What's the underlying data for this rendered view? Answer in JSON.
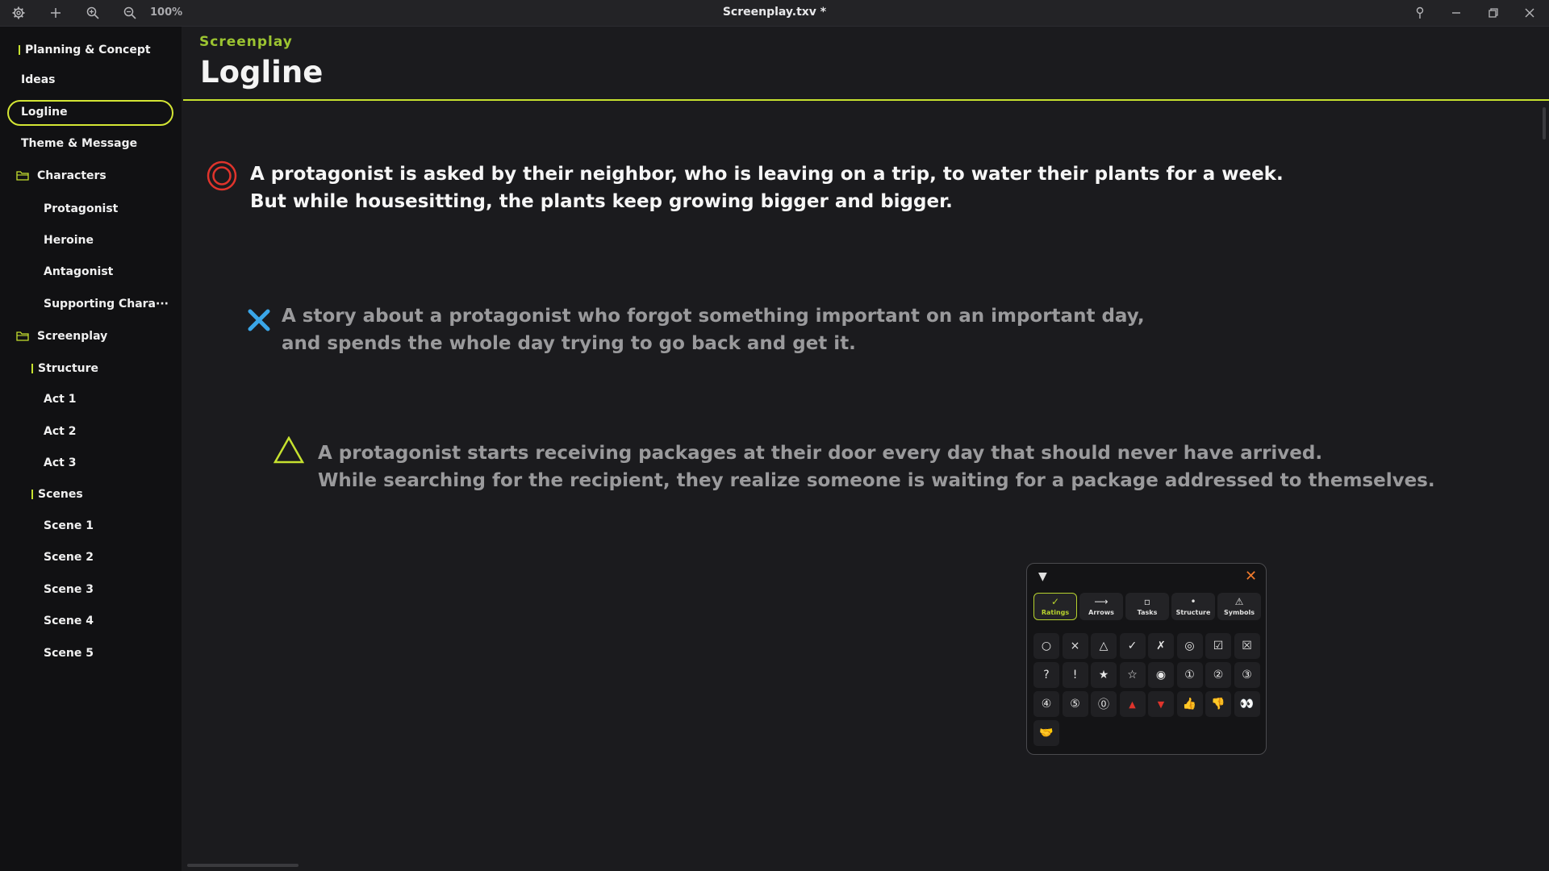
{
  "titlebar": {
    "zoom": "100%",
    "title": "Screenplay.txv *"
  },
  "sidebar": {
    "items": [
      {
        "label": "Planning & Concept",
        "kind": "section"
      },
      {
        "label": "Ideas",
        "kind": "item"
      },
      {
        "label": "Logline",
        "kind": "item",
        "active": true
      },
      {
        "label": "Theme & Message",
        "kind": "item"
      },
      {
        "label": "Characters",
        "kind": "folder"
      },
      {
        "label": "Protagonist",
        "kind": "sub"
      },
      {
        "label": "Heroine",
        "kind": "sub"
      },
      {
        "label": "Antagonist",
        "kind": "sub"
      },
      {
        "label": "Supporting Chara···",
        "kind": "sub"
      },
      {
        "label": "Screenplay",
        "kind": "folder"
      },
      {
        "label": "Structure",
        "kind": "subsection"
      },
      {
        "label": "Act 1",
        "kind": "sub"
      },
      {
        "label": "Act 2",
        "kind": "sub"
      },
      {
        "label": "Act 3",
        "kind": "sub"
      },
      {
        "label": "Scenes",
        "kind": "subsection"
      },
      {
        "label": "Scene 1",
        "kind": "sub"
      },
      {
        "label": "Scene 2",
        "kind": "sub"
      },
      {
        "label": "Scene 3",
        "kind": "sub"
      },
      {
        "label": "Scene 4",
        "kind": "sub"
      },
      {
        "label": "Scene 5",
        "kind": "sub"
      }
    ]
  },
  "main": {
    "subtitle": "Screenplay",
    "title": "Logline",
    "loglines": [
      {
        "mark": "double-circle",
        "lines": [
          "A protagonist is asked by their neighbor, who is leaving on a trip, to water their plants for a week.",
          "But while housesitting, the plants keep growing bigger and bigger."
        ]
      },
      {
        "mark": "cross",
        "lines": [
          "A story about a protagonist who forgot something important on an important day,",
          "and spends the whole day trying to go back and get it."
        ]
      },
      {
        "mark": "triangle",
        "lines": [
          "A protagonist starts receiving packages at their door every day that should never have arrived.",
          "While searching for the recipient, they realize someone is waiting for a package addressed to themselves."
        ]
      }
    ]
  },
  "palette": {
    "collapse_icon": "▼",
    "close_icon": "✕",
    "tabs": [
      {
        "icon": "✓",
        "label": "Ratings",
        "active": true
      },
      {
        "icon": "⟶",
        "label": "Arrows"
      },
      {
        "icon": "▫",
        "label": "Tasks"
      },
      {
        "icon": "•",
        "label": "Structure"
      },
      {
        "icon": "⚠",
        "label": "Symbols"
      }
    ],
    "symbols": [
      "○",
      "×",
      "△",
      "✓",
      "✗",
      "◎",
      "☑",
      "☒",
      "?",
      "!",
      "★",
      "☆",
      "◉",
      "①",
      "②",
      "③",
      "④",
      "⑤",
      "⓪",
      "▲",
      "▼",
      "👍",
      "👎",
      "👀",
      "🤝"
    ],
    "colors": {
      "accent": "#c6e12f",
      "close": "#f07a2c",
      "red": "#e0342c",
      "cross": "#3aa6e8"
    }
  }
}
